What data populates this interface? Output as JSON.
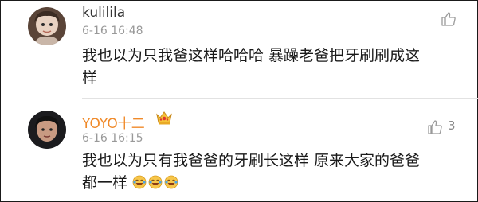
{
  "comments": [
    {
      "username": "kulililа",
      "timestamp": "6-16 16:48",
      "content_line1": "我也以为只我爸这样哈哈哈 暴躁老爸把牙刷刷成这",
      "content_line2": "样",
      "like_count": "",
      "icons": {
        "avatar": "user-avatar",
        "like": "thumbs-up-icon"
      }
    },
    {
      "username": "YOYO十二",
      "timestamp": "6-16 16:15",
      "content_line1": "我也以为只有我爸爸的牙刷长这样 原来大家的爸爸",
      "content_line2": "都一样",
      "like_count": "3",
      "icons": {
        "avatar": "user-avatar",
        "badge": "crown-badge-icon",
        "like": "thumbs-up-icon",
        "emoji": "laughing-tears-emoji"
      }
    }
  ],
  "colors": {
    "vip_username": "#f08a2a",
    "timestamp": "#999999",
    "text": "#1a1a1a"
  }
}
